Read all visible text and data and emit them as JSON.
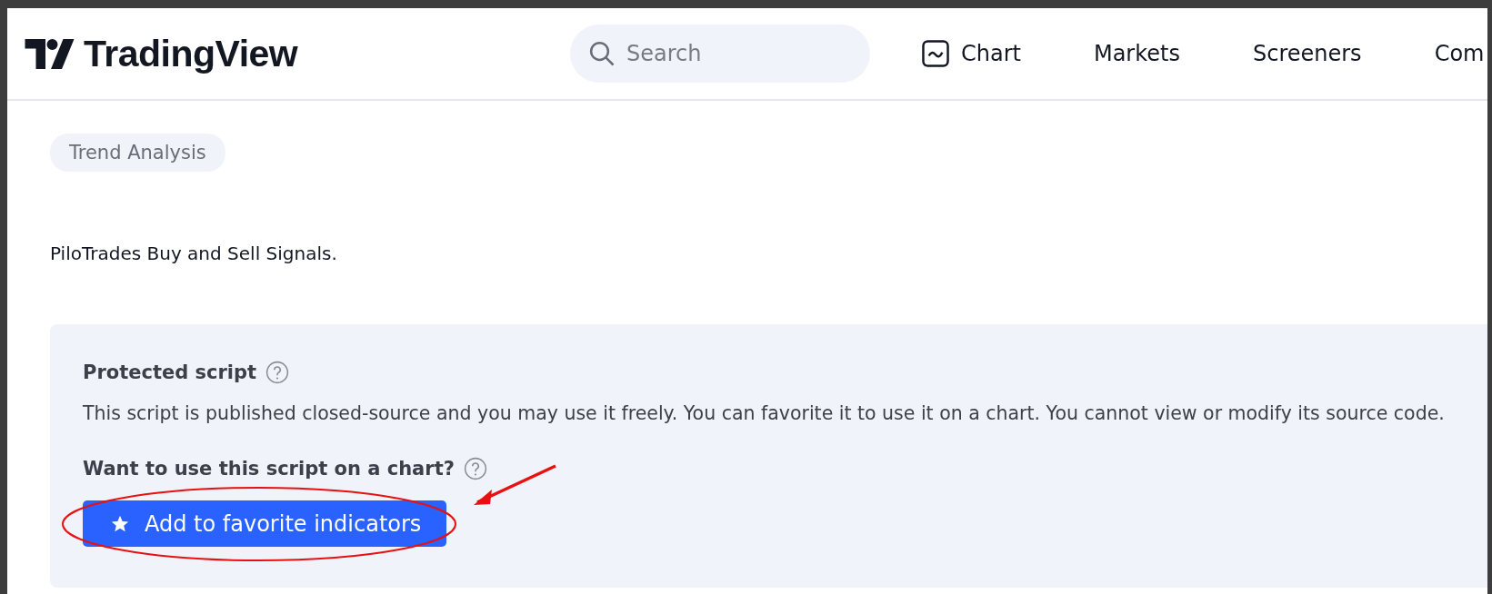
{
  "header": {
    "logo": "TradingView",
    "search": {
      "placeholder": "Search"
    },
    "nav": [
      {
        "label": "Chart",
        "kind": "icon"
      },
      {
        "label": "Markets",
        "kind": "plain"
      },
      {
        "label": "Screeners",
        "kind": "plain"
      },
      {
        "label": "Com",
        "kind": "plain"
      }
    ]
  },
  "tags": [
    "Trend Analysis"
  ],
  "description": "PiloTrades Buy and Sell Signals.",
  "notice": {
    "title": "Protected script",
    "text": "This script is published closed-source and you may use it freely. You can favorite it to use it on a chart. You cannot view or modify its source code.",
    "question": "Want to use this script on a chart?",
    "button": {
      "label": "Add to favorite indicators",
      "highlighted": true
    }
  }
}
